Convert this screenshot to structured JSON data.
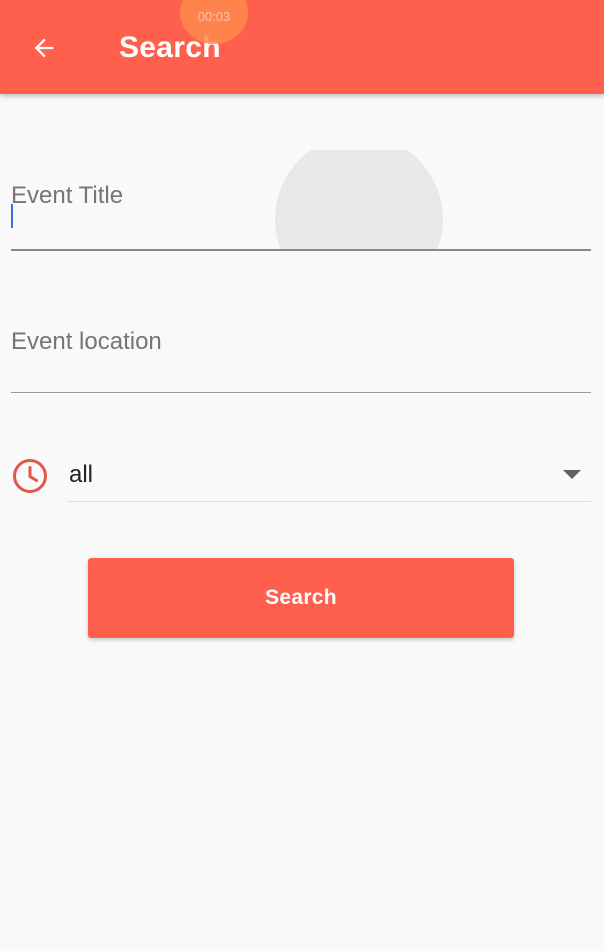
{
  "appbar": {
    "title": "Search",
    "back_icon": "arrow-back-icon",
    "background_color": "#ff5f4d"
  },
  "overlay": {
    "timer_text": "00:03"
  },
  "form": {
    "event_title": {
      "label": "Event Title",
      "value": ""
    },
    "event_location": {
      "label": "Event location",
      "value": ""
    },
    "time_filter": {
      "icon": "clock-icon",
      "selected": "all",
      "icon_color": "#e4584a"
    },
    "search_button": {
      "label": "Search",
      "color": "#ff5f4d"
    }
  }
}
